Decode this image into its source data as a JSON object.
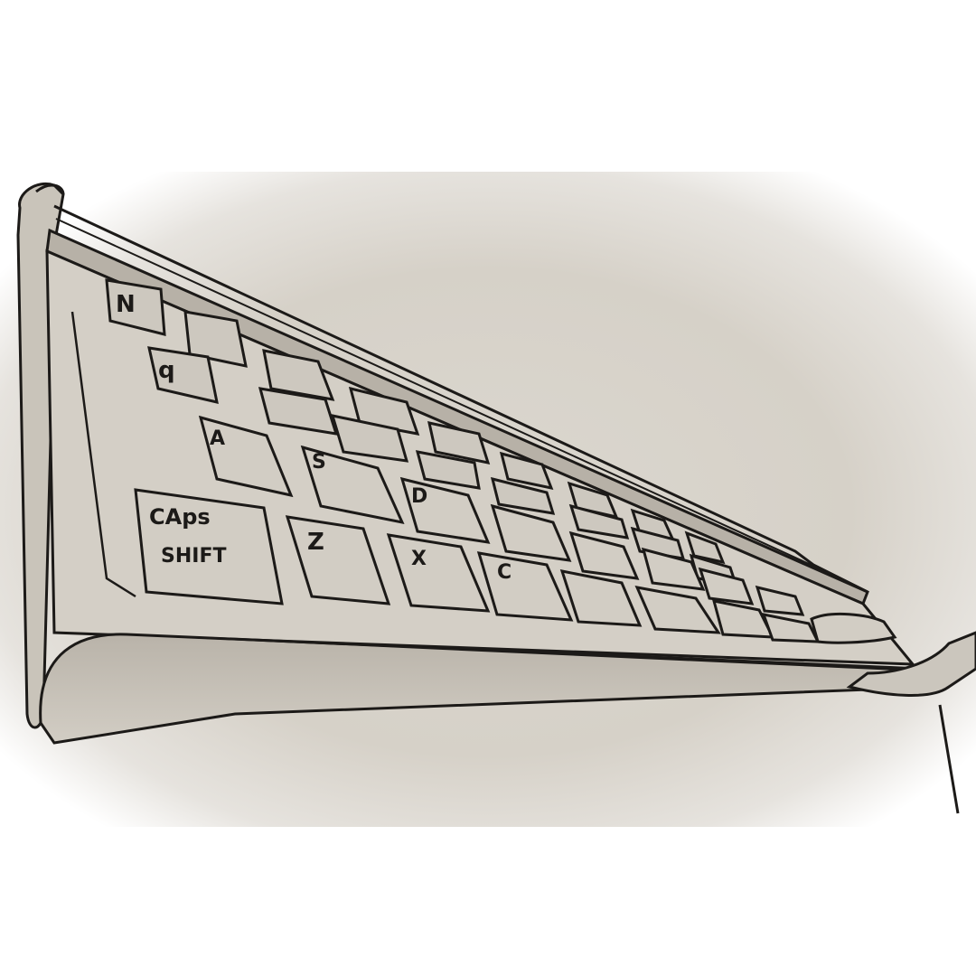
{
  "sketch": {
    "subject": "pencil sketch of a keyboard in perspective",
    "paper_color": "#dcd8d0",
    "ink_color": "#1c1a18",
    "key_labels": {
      "top_left_a": "N",
      "row2_a": "q",
      "a": "A",
      "s": "S",
      "d": "D",
      "caps_line1": "CAps",
      "caps_line2": "SHIFT",
      "z": "Z",
      "x": "X",
      "c": "C"
    }
  }
}
